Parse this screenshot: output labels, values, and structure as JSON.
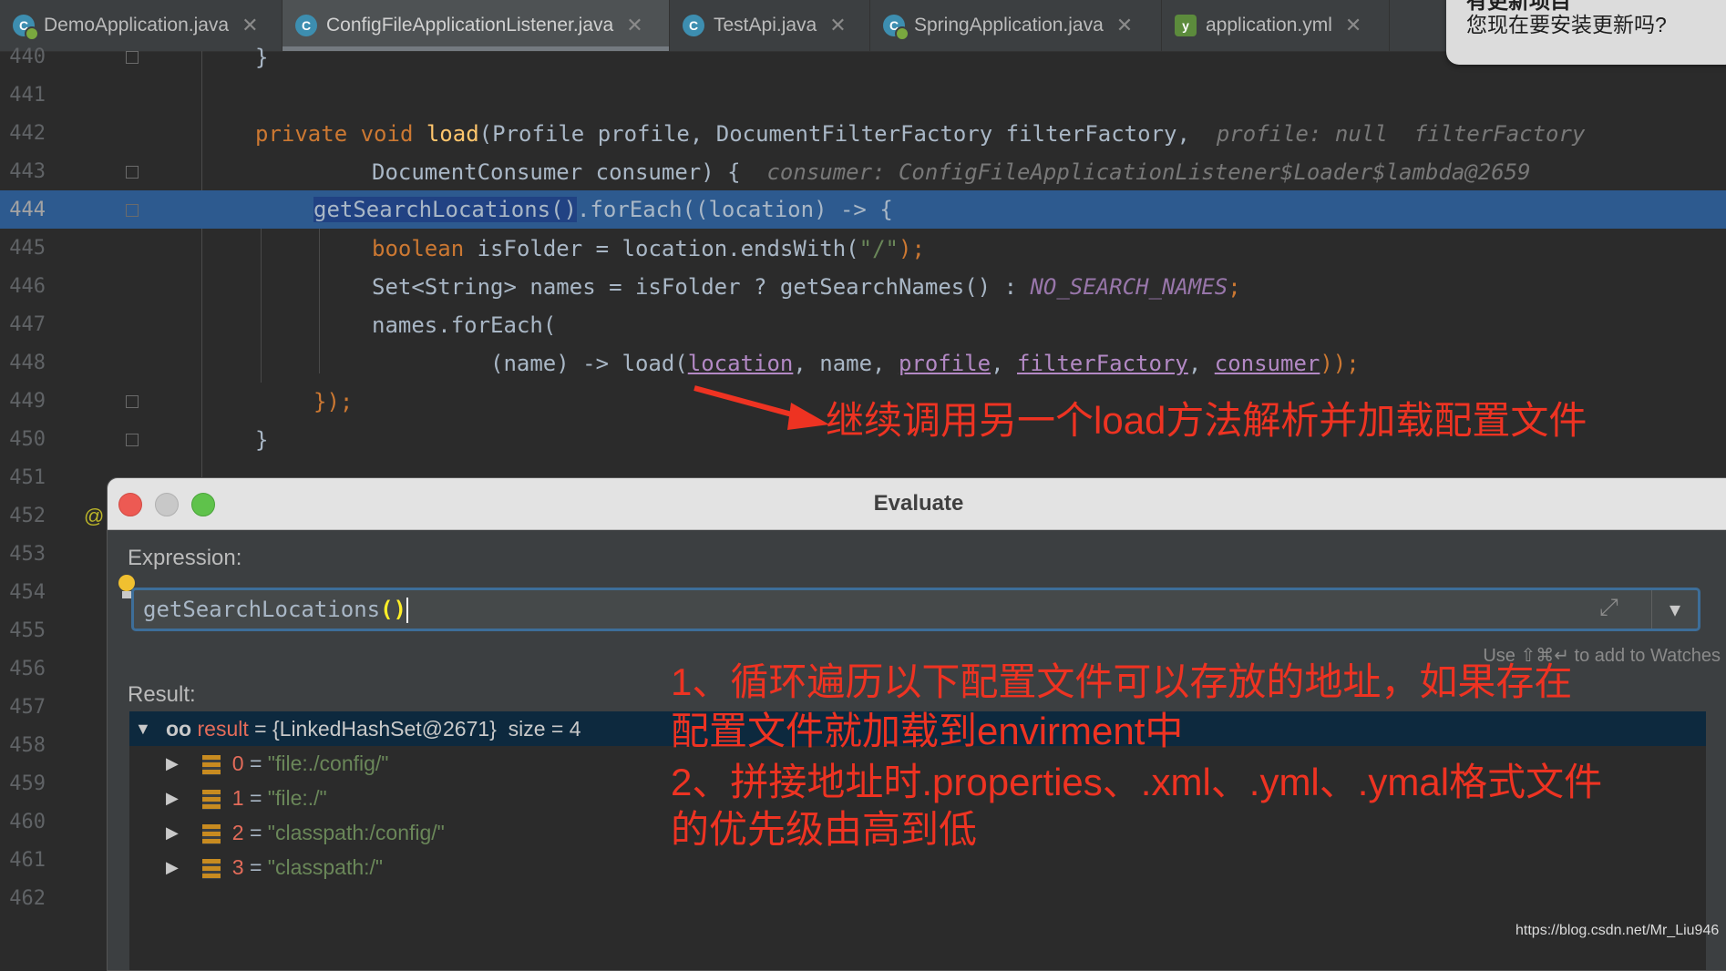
{
  "tabs": [
    {
      "label": "DemoApplication.java",
      "icon": "spring-class-icon"
    },
    {
      "label": "ConfigFileApplicationListener.java",
      "icon": "class-icon"
    },
    {
      "label": "TestApi.java",
      "icon": "class-icon"
    },
    {
      "label": "SpringApplication.java",
      "icon": "class-icon"
    },
    {
      "label": "application.yml",
      "icon": "yml-icon"
    }
  ],
  "close_glyph": "✕",
  "notification": {
    "line1": "有更新项目",
    "line2": "您现在要安装更新吗?"
  },
  "gutter": {
    "at": "@"
  },
  "line_numbers": [
    "440",
    "441",
    "442",
    "443",
    "444",
    "445",
    "446",
    "447",
    "448",
    "449",
    "450",
    "451",
    "452",
    "453",
    "454",
    "455",
    "456",
    "457",
    "458",
    "459",
    "460",
    "461",
    "462"
  ],
  "code": {
    "l440": "}",
    "l442_kw1": "private",
    "l442_kw2": "void",
    "l442_fn": "load",
    "l442_rest": "(Profile profile, DocumentFilterFactory filterFactory,",
    "l442_hint": "profile: null  filterFactory",
    "l443_code": "DocumentConsumer consumer) {",
    "l443_hint": "consumer: ConfigFileApplicationListener$Loader$lambda@2659",
    "l444_sel": "getSearchLocations()",
    "l444_rest": ".forEach((location) -> {",
    "l445_kw": "boolean",
    "l445_a": " isFolder = location.endsWith(",
    "l445_str": "\"/\"",
    "l445_b": ");",
    "l446_a": "Set<String> names = isFolder ? getSearchNames() : ",
    "l446_cst": "NO_SEARCH_NAMES",
    "l446_b": ";",
    "l447": "names.forEach(",
    "l448_a": "(name) -> load(",
    "l448_p1": "location",
    "l448_b": ", name, ",
    "l448_p2": "profile",
    "l448_c": ", ",
    "l448_p3": "filterFactory",
    "l448_d": ", ",
    "l448_p4": "consumer",
    "l448_e": "));",
    "l449": "});",
    "l450": "}"
  },
  "annotations": {
    "a1": "继续调用另一个load方法解析并加载配置文件",
    "a2_line1": "1、循环遍历以下配置文件可以存放的地址，如果存在",
    "a2_line2": "配置文件就加载到envirment中",
    "a3_line1": "2、拼接地址时.properties、.xml、.yml、.ymal格式文件",
    "a3_line2": "的优先级由高到低"
  },
  "dialog": {
    "title": "Evaluate",
    "expression_label": "Expression:",
    "expression_name": "getSearchLocations",
    "expression_parens": "()",
    "watch_hint": "Use ⇧⌘↵ to add to Watches",
    "result_label": "Result:",
    "result": {
      "glasses": "oo",
      "name": "result",
      "eq": " = ",
      "value": "{LinkedHashSet@2671}",
      "size": "size = 4",
      "items": [
        {
          "index": "0",
          "value": "\"file:./config/\""
        },
        {
          "index": "1",
          "value": "\"file:./\""
        },
        {
          "index": "2",
          "value": "\"classpath:/config/\""
        },
        {
          "index": "3",
          "value": "\"classpath:/\""
        }
      ]
    }
  },
  "watermark": "https://blog.csdn.net/Mr_Liu946",
  "colors": {
    "annotation": "#ee3322",
    "selection": "#2d5a8f",
    "keyword": "#cc7832"
  }
}
